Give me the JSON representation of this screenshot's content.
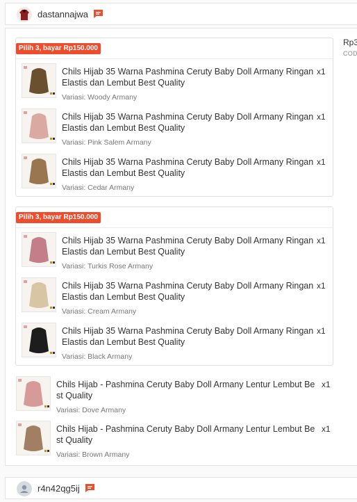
{
  "shops": [
    {
      "name": "dastannajwa"
    },
    {
      "name": "r4n42qg5ij"
    }
  ],
  "order": {
    "price_truncated": "Rp3",
    "payment_method_truncated": "COD"
  },
  "bundles": [
    {
      "badge": "Pilih 3, bayar Rp150.000",
      "items": [
        {
          "title": "Chils Hijab 35 Warna Pashmina Ceruty Baby Doll Armany Ringan Elastis dan Lembut Best Quality",
          "qty": "x1",
          "variant": "Variasi: Woody Armany",
          "color": "#6b5030"
        },
        {
          "title": "Chils Hijab 35 Warna Pashmina Ceruty Baby Doll Armany Ringan Elastis dan Lembut Best Quality",
          "qty": "x1",
          "variant": "Variasi: Pink Salem Armany",
          "color": "#d9a9a2"
        },
        {
          "title": "Chils Hijab 35 Warna Pashmina Ceruty Baby Doll Armany Ringan Elastis dan Lembut Best Quality",
          "qty": "x1",
          "variant": "Variasi: Cedar Armany",
          "color": "#9a7650"
        }
      ]
    },
    {
      "badge": "Pilih 3, bayar Rp150.000",
      "items": [
        {
          "title": "Chils Hijab 35 Warna Pashmina Ceruty Baby Doll Armany Ringan Elastis dan Lembut Best Quality",
          "qty": "x1",
          "variant": "Variasi: Turkis Rose Armany",
          "color": "#c47e8a"
        },
        {
          "title": "Chils Hijab 35 Warna Pashmina Ceruty Baby Doll Armany Ringan Elastis dan Lembut Best Quality",
          "qty": "x1",
          "variant": "Variasi: Cream Armany",
          "color": "#d8c5a3"
        },
        {
          "title": "Chils Hijab 35 Warna Pashmina Ceruty Baby Doll Armany Ringan Elastis dan Lembut Best Quality",
          "qty": "x1",
          "variant": "Variasi: Black Armany",
          "color": "#1d1d1d"
        }
      ]
    }
  ],
  "single_items": [
    {
      "title": "Chils Hijab - Pashmina Ceruty Baby Doll Armany Lentur Lembut Be st Quality",
      "qty": "x1",
      "variant": "Variasi: Dove Armany",
      "color": "#d69a98"
    },
    {
      "title": "Chils Hijab - Pashmina Ceruty Baby Doll Armany Lentur Lembut Be st Quality",
      "qty": "x1",
      "variant": "Variasi: Brown Armany",
      "color": "#a07f62"
    }
  ],
  "colors": {
    "accent": "#ee4d2d",
    "border": "#e4e4e4"
  },
  "icons": {
    "chat": "chat-bubble-icon",
    "avatar_default": "user-icon"
  }
}
